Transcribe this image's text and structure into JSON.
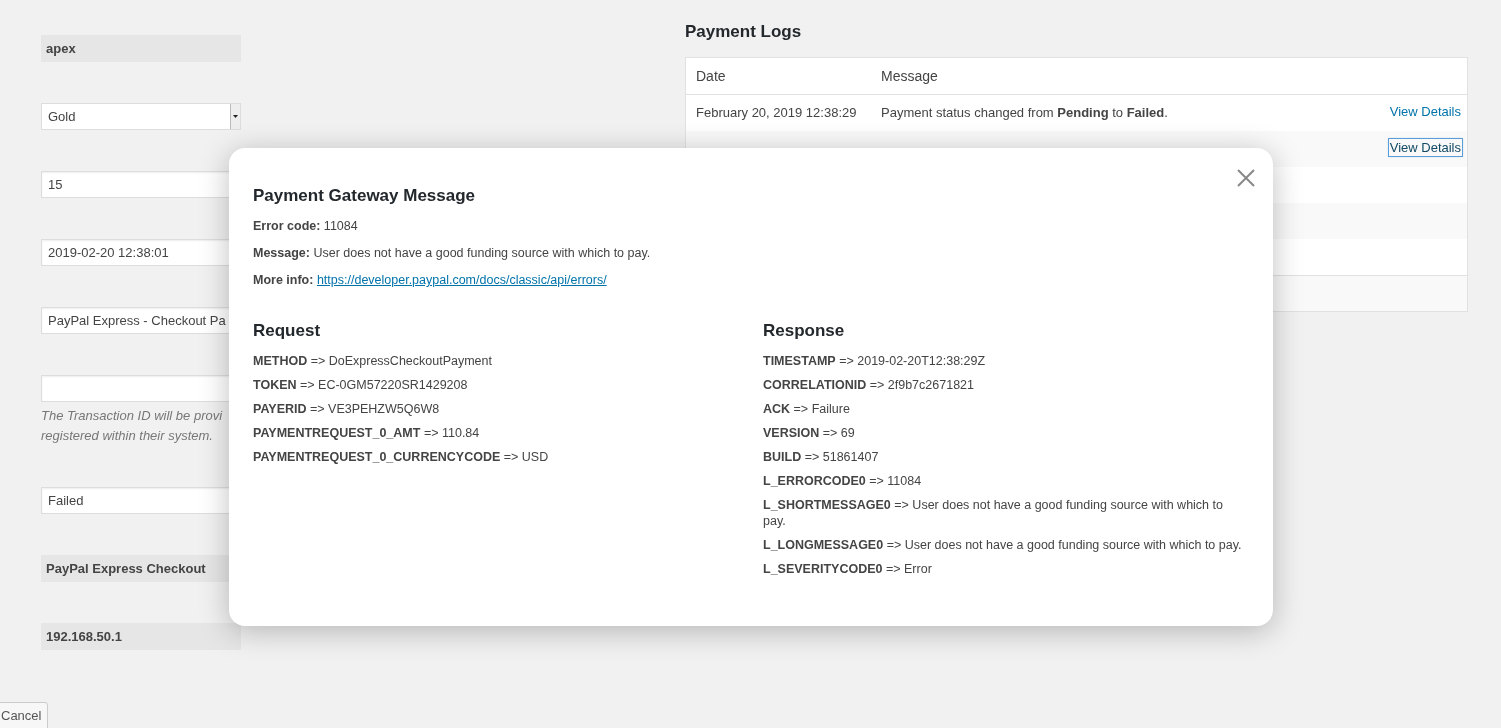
{
  "form": {
    "fields": [
      {
        "kind": "static",
        "value": "apex"
      },
      {
        "kind": "select",
        "value": "Gold"
      },
      {
        "kind": "input",
        "value": "15"
      },
      {
        "kind": "input",
        "value": "2019-02-20 12:38:01"
      },
      {
        "kind": "input",
        "value": "PayPal Express - Checkout Pa"
      },
      {
        "kind": "input",
        "help": [
          "The Transaction ID will be provi",
          "registered within their system."
        ]
      },
      {
        "kind": "input",
        "value": "Failed"
      },
      {
        "kind": "static",
        "value": "PayPal Express Checkout"
      },
      {
        "kind": "static",
        "value": "192.168.50.1"
      }
    ],
    "cancel_button": "Cancel"
  },
  "payment_logs": {
    "title": "Payment Logs",
    "columns": [
      "Date",
      "Message"
    ],
    "rows": [
      {
        "date": "February 20, 2019 12:38:29",
        "message": "Payment status changed from **Pending** to **Failed**.",
        "action": "View Details",
        "focused": false
      },
      {
        "action": "View Details",
        "focused": true
      }
    ]
  },
  "modal": {
    "title": "Payment Gateway Message",
    "info": [
      "**Error code:** 11084",
      "**Message:** User does not have a good funding source with which to pay."
    ],
    "more_info": {
      "label": "More info:",
      "link": "https://developer.paypal.com/docs/classic/api/errors/"
    },
    "request": {
      "title": "Request",
      "lines": [
        "**METHOD** => DoExpressCheckoutPayment",
        "**TOKEN** => EC-0GM57220SR1429208",
        "**PAYERID** => VE3PEHZW5Q6W8",
        "**PAYMENTREQUEST_0_AMT** => 110.84",
        "**PAYMENTREQUEST_0_CURRENCYCODE** => USD"
      ]
    },
    "response": {
      "title": "Response",
      "lines": [
        "**TIMESTAMP** => 2019-02-20T12:38:29Z",
        "**CORRELATIONID** => 2f9b7c2671821",
        "**ACK** => Failure",
        "**VERSION** => 69",
        "**BUILD** => 51861407",
        "**L_ERRORCODE0** => 11084",
        "**L_SHORTMESSAGE0** => User does not have a good funding source with which to pay.",
        "**L_LONGMESSAGE0** => User does not have a good funding source with which to pay.",
        "**L_SEVERITYCODE0** => Error"
      ]
    }
  }
}
